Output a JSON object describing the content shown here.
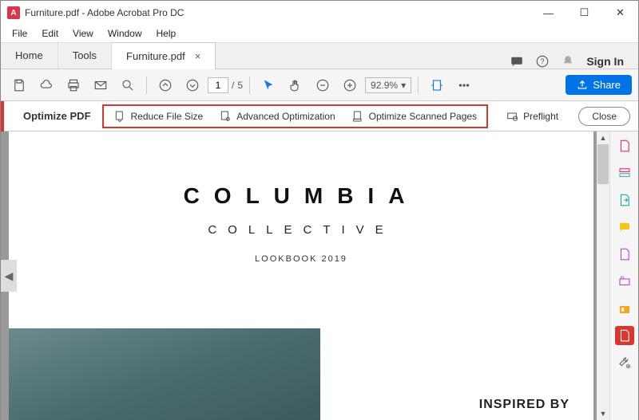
{
  "window": {
    "title": "Furniture.pdf - Adobe Acrobat Pro DC",
    "app_letter": "A"
  },
  "menubar": {
    "items": [
      "File",
      "Edit",
      "View",
      "Window",
      "Help"
    ]
  },
  "tabs": {
    "home": "Home",
    "tools": "Tools",
    "active": "Furniture.pdf"
  },
  "topright": {
    "signin": "Sign In"
  },
  "toolbar": {
    "page_current": "1",
    "page_sep": "/",
    "page_total": "5",
    "zoom": "92.9%",
    "share": "Share"
  },
  "optbar": {
    "title": "Optimize PDF",
    "reduce": "Reduce File Size",
    "advanced": "Advanced Optimization",
    "scanned": "Optimize Scanned Pages",
    "preflight": "Preflight",
    "close": "Close"
  },
  "doc": {
    "h1": "COLUMBIA",
    "h2": "COLLECTIVE",
    "h3": "LOOKBOOK 2019",
    "inspired": "INSPIRED BY"
  }
}
